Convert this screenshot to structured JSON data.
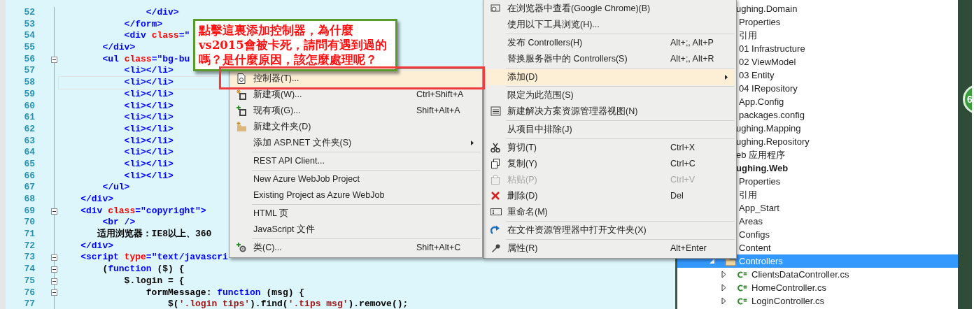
{
  "editor": {
    "lines": [
      {
        "number": "52",
        "fold": false,
        "current": false,
        "tokens": [
          {
            "kind": "tag",
            "text": "                </div>"
          }
        ]
      },
      {
        "number": "53",
        "fold": false,
        "current": false,
        "tokens": [
          {
            "kind": "tag",
            "text": "            </form>"
          }
        ]
      },
      {
        "number": "54",
        "fold": false,
        "current": false,
        "tokens": [
          {
            "kind": "tag",
            "text": "            <div "
          },
          {
            "kind": "attr",
            "text": "class"
          },
          {
            "kind": "tag",
            "text": "=\""
          }
        ]
      },
      {
        "number": "55",
        "fold": false,
        "current": false,
        "tokens": [
          {
            "kind": "tag",
            "text": "        </div>"
          }
        ]
      },
      {
        "number": "56",
        "fold": true,
        "current": false,
        "tokens": [
          {
            "kind": "tag",
            "text": "        <ul "
          },
          {
            "kind": "attr",
            "text": "class"
          },
          {
            "kind": "tag",
            "text": "=\"bg-bu"
          }
        ]
      },
      {
        "number": "57",
        "fold": false,
        "current": false,
        "tokens": [
          {
            "kind": "tag",
            "text": "            <li></li>"
          }
        ]
      },
      {
        "number": "58",
        "fold": false,
        "current": true,
        "tokens": [
          {
            "kind": "tag",
            "text": "            <li></li>"
          }
        ]
      },
      {
        "number": "59",
        "fold": false,
        "current": false,
        "tokens": [
          {
            "kind": "tag",
            "text": "            <li></li>"
          }
        ]
      },
      {
        "number": "60",
        "fold": false,
        "current": false,
        "tokens": [
          {
            "kind": "tag",
            "text": "            <li></li>"
          }
        ]
      },
      {
        "number": "61",
        "fold": false,
        "current": false,
        "tokens": [
          {
            "kind": "tag",
            "text": "            <li></li>"
          }
        ]
      },
      {
        "number": "62",
        "fold": false,
        "current": false,
        "tokens": [
          {
            "kind": "tag",
            "text": "            <li></li>"
          }
        ]
      },
      {
        "number": "63",
        "fold": false,
        "current": false,
        "tokens": [
          {
            "kind": "tag",
            "text": "            <li></li>"
          }
        ]
      },
      {
        "number": "64",
        "fold": false,
        "current": false,
        "tokens": [
          {
            "kind": "tag",
            "text": "            <li></li>"
          }
        ]
      },
      {
        "number": "65",
        "fold": false,
        "current": false,
        "tokens": [
          {
            "kind": "tag",
            "text": "            <li></li>"
          }
        ]
      },
      {
        "number": "66",
        "fold": false,
        "current": false,
        "tokens": [
          {
            "kind": "tag",
            "text": "            <li></li>"
          }
        ]
      },
      {
        "number": "67",
        "fold": false,
        "current": false,
        "tokens": [
          {
            "kind": "tag",
            "text": "        </ul>"
          }
        ]
      },
      {
        "number": "68",
        "fold": false,
        "current": false,
        "tokens": [
          {
            "kind": "tag",
            "text": "    </div>"
          }
        ]
      },
      {
        "number": "69",
        "fold": true,
        "current": false,
        "tokens": [
          {
            "kind": "tag",
            "text": "    <div "
          },
          {
            "kind": "attr",
            "text": "class"
          },
          {
            "kind": "tag",
            "text": "=\"copyright\">"
          }
        ]
      },
      {
        "number": "70",
        "fold": false,
        "current": false,
        "tokens": [
          {
            "kind": "tag",
            "text": "        <br />"
          }
        ]
      },
      {
        "number": "71",
        "fold": false,
        "current": false,
        "tokens": [
          {
            "kind": "text",
            "text": "       适用浏览器：IE8以上、360"
          }
        ]
      },
      {
        "number": "72",
        "fold": false,
        "current": false,
        "tokens": [
          {
            "kind": "tag",
            "text": "    </div>"
          }
        ]
      },
      {
        "number": "73",
        "fold": true,
        "current": false,
        "tokens": [
          {
            "kind": "tag",
            "text": "    <script "
          },
          {
            "kind": "attr",
            "text": "type"
          },
          {
            "kind": "tag",
            "text": "=\"text/javascri"
          }
        ]
      },
      {
        "number": "74",
        "fold": true,
        "current": false,
        "tokens": [
          {
            "kind": "text",
            "text": "        ("
          },
          {
            "kind": "keyword",
            "text": "function"
          },
          {
            "kind": "text",
            "text": " ($) {"
          }
        ]
      },
      {
        "number": "75",
        "fold": true,
        "current": false,
        "tokens": [
          {
            "kind": "text",
            "text": "            $.login = {"
          }
        ]
      },
      {
        "number": "76",
        "fold": true,
        "current": false,
        "tokens": [
          {
            "kind": "text",
            "text": "                formMessage: "
          },
          {
            "kind": "keyword",
            "text": "function"
          },
          {
            "kind": "text",
            "text": " (msg) {"
          }
        ]
      },
      {
        "number": "77",
        "fold": false,
        "current": false,
        "tokens": [
          {
            "kind": "text",
            "text": "                    $("
          },
          {
            "kind": "string",
            "text": "'.login tips'"
          },
          {
            "kind": "text",
            "text": ").find("
          },
          {
            "kind": "string",
            "text": "'.tips msg'"
          },
          {
            "kind": "text",
            "text": ").remove();"
          }
        ]
      }
    ]
  },
  "annotation": {
    "text": "點擊這裏添加控制器，為什麼vs2015會被卡死，請問有遇到過的嗎？是什麼原因，該怎麼處理呢？"
  },
  "context_menu": {
    "items": [
      {
        "kind": "browser",
        "label": "在浏览器中查看(Google Chrome)(B)",
        "selected": false,
        "disabled": false
      },
      {
        "kind": "plain",
        "label": "使用以下工具浏览(H)...",
        "selected": false,
        "disabled": false
      },
      {
        "kind": "separator"
      },
      {
        "kind": "plain",
        "label": "发布 Controllers(H)",
        "shortcut": "Alt+;, Alt+P",
        "selected": false,
        "disabled": false
      },
      {
        "kind": "plain",
        "label": "替换服务器中的 Controllers(S)",
        "shortcut": "Alt+;, Alt+R",
        "selected": false,
        "disabled": false
      },
      {
        "kind": "separator"
      },
      {
        "kind": "submenu",
        "label": "添加(D)",
        "selected": true,
        "disabled": false
      },
      {
        "kind": "separator"
      },
      {
        "kind": "plain",
        "label": "限定为此范围(S)",
        "selected": false,
        "disabled": false
      },
      {
        "kind": "newview",
        "label": "新建解决方案资源管理器视图(N)",
        "selected": false,
        "disabled": false
      },
      {
        "kind": "separator"
      },
      {
        "kind": "plain",
        "label": "从项目中排除(J)",
        "selected": false,
        "disabled": false
      },
      {
        "kind": "separator"
      },
      {
        "kind": "cut",
        "label": "剪切(T)",
        "shortcut": "Ctrl+X",
        "selected": false,
        "disabled": false
      },
      {
        "kind": "copy",
        "label": "复制(Y)",
        "shortcut": "Ctrl+C",
        "selected": false,
        "disabled": false
      },
      {
        "kind": "paste",
        "label": "粘贴(P)",
        "shortcut": "Ctrl+V",
        "selected": false,
        "disabled": true
      },
      {
        "kind": "delete",
        "label": "删除(D)",
        "shortcut": "Del",
        "selected": false,
        "disabled": false
      },
      {
        "kind": "rename",
        "label": "重命名(M)",
        "selected": false,
        "disabled": false
      },
      {
        "kind": "separator"
      },
      {
        "kind": "open",
        "label": "在文件资源管理器中打开文件夹(X)",
        "selected": false,
        "disabled": false
      },
      {
        "kind": "separator"
      },
      {
        "kind": "properties",
        "label": "属性(R)",
        "shortcut": "Alt+Enter",
        "selected": false,
        "disabled": false
      }
    ]
  },
  "add_submenu": {
    "items": [
      {
        "kind": "controller",
        "label": "控制器(T)...",
        "selected": true,
        "disabled": false
      },
      {
        "kind": "newitem",
        "label": "新建项(W)...",
        "shortcut": "Ctrl+Shift+A",
        "selected": false,
        "disabled": false
      },
      {
        "kind": "existing",
        "label": "现有项(G)...",
        "shortcut": "Shift+Alt+A",
        "selected": false,
        "disabled": false
      },
      {
        "kind": "folder",
        "label": "新建文件夹(D)",
        "selected": false,
        "disabled": false
      },
      {
        "kind": "submenu",
        "label": "添加 ASP.NET 文件夹(S)",
        "selected": false,
        "disabled": false
      },
      {
        "kind": "separator"
      },
      {
        "kind": "plain",
        "label": "REST API Client...",
        "selected": false,
        "disabled": false
      },
      {
        "kind": "separator"
      },
      {
        "kind": "plain",
        "label": "New Azure WebJob Project",
        "selected": false,
        "disabled": false
      },
      {
        "kind": "plain",
        "label": "Existing Project as Azure WebJob",
        "selected": false,
        "disabled": false
      },
      {
        "kind": "separator"
      },
      {
        "kind": "plain",
        "label": "HTML 页",
        "selected": false,
        "disabled": false
      },
      {
        "kind": "plain",
        "label": "JavaScript 文件",
        "selected": false,
        "disabled": false
      },
      {
        "kind": "separator"
      },
      {
        "kind": "class",
        "label": "类(C)...",
        "shortcut": "Shift+Alt+C",
        "selected": false,
        "disabled": false
      }
    ]
  },
  "solution_explorer": {
    "items": [
      {
        "text": "ughing.Domain",
        "selected": false,
        "startup": false,
        "children": [
          {
            "text": "Properties",
            "selected": false,
            "startup": false
          },
          {
            "text": "引用",
            "selected": false,
            "startup": false
          },
          {
            "text": "01 Infrastructure",
            "selected": false,
            "startup": false
          },
          {
            "text": "02 ViewModel",
            "selected": false,
            "startup": false
          },
          {
            "text": "03 Entity",
            "selected": false,
            "startup": false
          },
          {
            "text": "04 IRepository",
            "selected": false,
            "startup": false
          },
          {
            "text": "App.Config",
            "selected": false,
            "startup": false
          },
          {
            "text": "packages.config",
            "selected": false,
            "startup": false
          }
        ]
      },
      {
        "text": "ughing.Mapping",
        "selected": false,
        "startup": false
      },
      {
        "text": "ughing.Repository",
        "selected": false,
        "startup": false
      },
      {
        "text": "eb 应用程序",
        "selected": false,
        "startup": false
      },
      {
        "text": "ughing.Web",
        "selected": false,
        "startup": true,
        "children": [
          {
            "text": "Properties",
            "selected": false,
            "startup": false
          },
          {
            "text": "引用",
            "selected": false,
            "startup": false
          },
          {
            "text": "App_Start",
            "selected": false,
            "startup": false
          },
          {
            "text": "Areas",
            "selected": false,
            "startup": false
          },
          {
            "text": "Configs",
            "selected": false,
            "startup": false
          },
          {
            "text": "Content",
            "selected": false,
            "startup": false
          },
          {
            "text": "Controllers",
            "kind": "folder",
            "expanded": true,
            "selected": true,
            "startup": false,
            "children": [
              {
                "text": "ClientsDataController.cs",
                "kind": "csharp",
                "expanded": false,
                "selected": false,
                "startup": false
              },
              {
                "text": "HomeController.cs",
                "kind": "csharp",
                "expanded": false,
                "selected": false,
                "startup": false
              },
              {
                "text": "LoginController.cs",
                "kind": "csharp",
                "expanded": false,
                "selected": false,
                "startup": false
              }
            ]
          }
        ]
      }
    ]
  },
  "side_badge": {
    "text": "6"
  }
}
